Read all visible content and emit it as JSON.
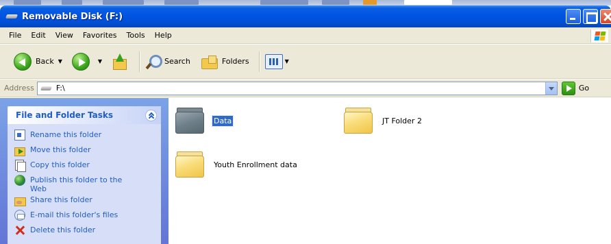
{
  "window": {
    "title": "Removable Disk (F:)"
  },
  "menu": [
    "File",
    "Edit",
    "View",
    "Favorites",
    "Tools",
    "Help"
  ],
  "toolbar": {
    "back_label": "Back",
    "search_label": "Search",
    "folders_label": "Folders"
  },
  "address": {
    "label": "Address",
    "value": "F:\\",
    "go_label": "Go"
  },
  "taskpane": {
    "title": "File and Folder Tasks",
    "tasks": [
      {
        "label": "Rename this folder",
        "icon": "rename-icon"
      },
      {
        "label": "Move this folder",
        "icon": "move-icon"
      },
      {
        "label": "Copy this folder",
        "icon": "copy-icon"
      },
      {
        "label": "Publish this folder to the Web",
        "icon": "publish-web-icon"
      },
      {
        "label": "Share this folder",
        "icon": "share-icon"
      },
      {
        "label": "E-mail this folder's files",
        "icon": "email-icon"
      },
      {
        "label": "Delete this folder",
        "icon": "delete-icon"
      }
    ]
  },
  "items": [
    {
      "name": "Data",
      "selected": true
    },
    {
      "name": "JT Folder 2",
      "selected": false
    },
    {
      "name": "Youth Enrollment data",
      "selected": false
    }
  ],
  "colors": {
    "titlebar": "#0054e3",
    "taskpane_bg": "#6f8ce0",
    "task_link": "#215dc6",
    "selection": "#316ac5"
  }
}
